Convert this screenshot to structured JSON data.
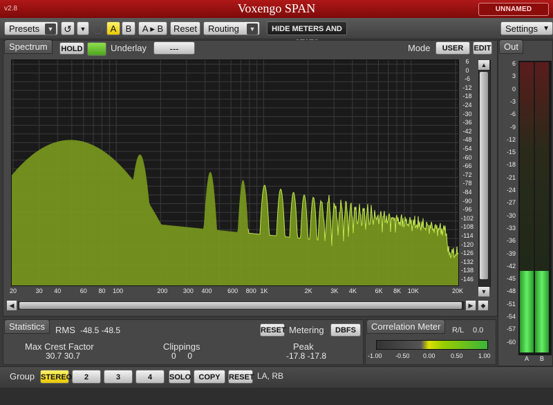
{
  "title_bar": {
    "version": "v2.8",
    "title": "Voxengo SPAN",
    "instance": "UNNAMED INSTANCE"
  },
  "toolbar": {
    "presets": "Presets",
    "a": "A",
    "b": "B",
    "a_to_b": "A ▸ B",
    "reset": "Reset",
    "routing": "Routing",
    "hide_meters": "HIDE METERS AND STATS",
    "settings": "Settings"
  },
  "spectrum": {
    "tab": "Spectrum",
    "hold": "HOLD",
    "underlay_label": "Underlay",
    "underlay_value": "---",
    "mode_label": "Mode",
    "mode_user": "USER",
    "mode_edit": "EDIT",
    "db_labels": [
      "6",
      "0",
      "-6",
      "-12",
      "-18",
      "-24",
      "-30",
      "-36",
      "-42",
      "-48",
      "-54",
      "-60",
      "-66",
      "-72",
      "-78",
      "-84",
      "-90",
      "-96",
      "-102",
      "-108",
      "-114",
      "-120",
      "-126",
      "-132",
      "-138",
      "-146"
    ],
    "freq_labels": [
      "20",
      "30",
      "40",
      "60",
      "80",
      "100",
      "200",
      "300",
      "400",
      "600",
      "800",
      "1K",
      "2K",
      "3K",
      "4K",
      "6K",
      "8K",
      "10K",
      "20K"
    ]
  },
  "out": {
    "tab": "Out",
    "labels": [
      "6",
      "3",
      "0",
      "-3",
      "-6",
      "-9",
      "-12",
      "-15",
      "-18",
      "-21",
      "-24",
      "-27",
      "-30",
      "-33",
      "-36",
      "-39",
      "-42",
      "-45",
      "-48",
      "-51",
      "-54",
      "-57",
      "-60"
    ],
    "ch_a": "A",
    "ch_b": "B",
    "level_a": 0.6,
    "level_b": 0.6
  },
  "statistics": {
    "tab": "Statistics",
    "rms_label": "RMS",
    "rms_values": "-48.5  -48.5",
    "reset": "RESET",
    "metering_label": "Metering",
    "metering_value": "DBFS",
    "crest_label": "Max Crest Factor",
    "crest_values": "30.7  30.7",
    "clip_label": "Clippings",
    "clip_values": "0     0",
    "peak_label": "Peak",
    "peak_values": "-17.8  -17.8"
  },
  "correlation": {
    "tab": "Correlation Meter",
    "rl": "R/L",
    "value": "0.0",
    "scale": [
      "-1.00",
      "-0.50",
      "0.00",
      "0.50",
      "1.00"
    ]
  },
  "group": {
    "label": "Group",
    "stereo": "STEREO",
    "g2": "2",
    "g3": "3",
    "g4": "4",
    "solo": "SOLO",
    "copy_to": "COPY TO",
    "reset": "RESET",
    "channels": "LA, RB"
  },
  "colors": {
    "title_red": "#9a1010",
    "spectrum_fill": "#7a9a1e",
    "spectrum_line": "#b8dc40",
    "meter_green": "#3fd63f",
    "accent_yellow": "#f4e000"
  }
}
